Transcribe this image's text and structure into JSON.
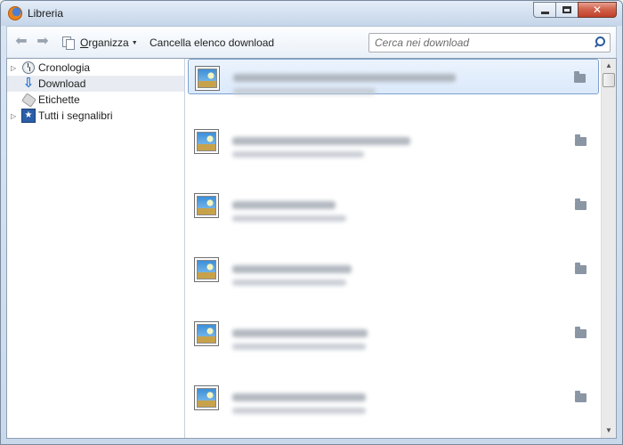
{
  "window": {
    "title": "Libreria",
    "icon": "firefox-icon"
  },
  "toolbar": {
    "organize_label_accel": "O",
    "organize_label_rest": "rganizza",
    "clear_label": "Cancella elenco download",
    "search_placeholder": "Cerca nei download"
  },
  "sidebar": {
    "items": [
      {
        "label": "Cronologia",
        "icon": "clock-icon",
        "expandable": true,
        "selected": false
      },
      {
        "label": "Download",
        "icon": "download-arrow-icon",
        "expandable": false,
        "selected": true
      },
      {
        "label": "Etichette",
        "icon": "tag-icon",
        "expandable": false,
        "selected": false
      },
      {
        "label": "Tutti i segnalibri",
        "icon": "bookmarks-icon",
        "expandable": true,
        "selected": false
      }
    ]
  },
  "downloads": {
    "selected_index": 0,
    "count": 6,
    "item_icon": "image-file-icon",
    "action_icon": "folder-icon"
  },
  "colors": {
    "selection_border": "#7da2ce",
    "selection_fill": "#dbe9fb",
    "accent_blue": "#1e6fd0"
  }
}
